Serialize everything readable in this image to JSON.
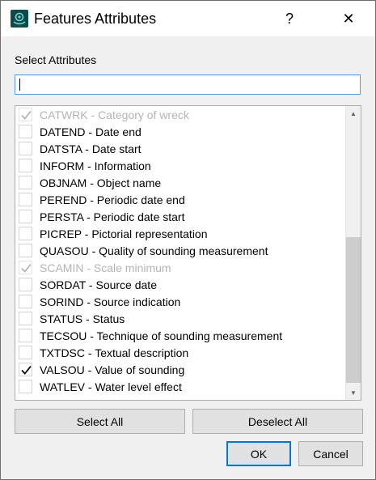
{
  "window": {
    "title": "Features Attributes",
    "help_glyph": "?",
    "close_glyph": "✕",
    "icon": "app-logo-icon"
  },
  "search": {
    "label": "Select Attributes",
    "value": "",
    "placeholder": ""
  },
  "attributes": [
    {
      "label": "CATWRK - Category of wreck",
      "checked": true,
      "disabled": true
    },
    {
      "label": "DATEND - Date end",
      "checked": false,
      "disabled": false
    },
    {
      "label": "DATSTA - Date start",
      "checked": false,
      "disabled": false
    },
    {
      "label": "INFORM - Information",
      "checked": false,
      "disabled": false
    },
    {
      "label": "OBJNAM - Object name",
      "checked": false,
      "disabled": false
    },
    {
      "label": "PEREND - Periodic date end",
      "checked": false,
      "disabled": false
    },
    {
      "label": "PERSTA - Periodic date start",
      "checked": false,
      "disabled": false
    },
    {
      "label": "PICREP - Pictorial representation",
      "checked": false,
      "disabled": false
    },
    {
      "label": "QUASOU - Quality of sounding measurement",
      "checked": false,
      "disabled": false
    },
    {
      "label": "SCAMIN - Scale minimum",
      "checked": true,
      "disabled": true
    },
    {
      "label": "SORDAT - Source date",
      "checked": false,
      "disabled": false
    },
    {
      "label": "SORIND - Source indication",
      "checked": false,
      "disabled": false
    },
    {
      "label": "STATUS - Status",
      "checked": false,
      "disabled": false
    },
    {
      "label": "TECSOU - Technique of sounding measurement",
      "checked": false,
      "disabled": false
    },
    {
      "label": "TXTDSC - Textual description",
      "checked": false,
      "disabled": false
    },
    {
      "label": "VALSOU - Value of sounding",
      "checked": true,
      "disabled": false
    },
    {
      "label": "WATLEV - Water level effect",
      "checked": false,
      "disabled": false
    }
  ],
  "buttons": {
    "select_all": "Select All",
    "deselect_all": "Deselect All",
    "ok": "OK",
    "cancel": "Cancel"
  },
  "scrollbar": {
    "up_glyph": "▲",
    "down_glyph": "▼"
  },
  "colors": {
    "accent": "#0078d7",
    "disabled_text": "#b4b4b4"
  }
}
